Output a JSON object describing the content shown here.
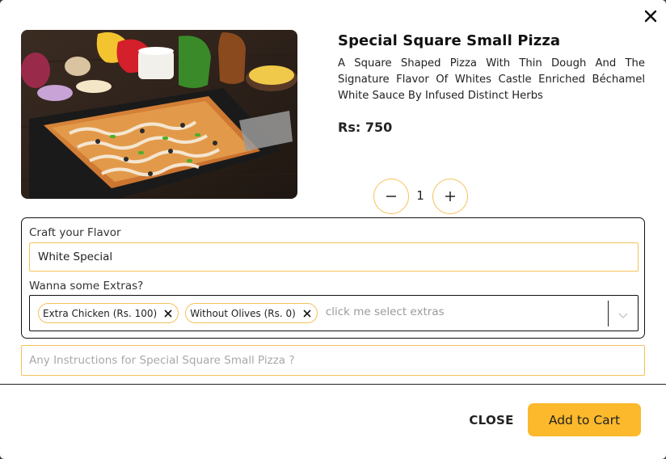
{
  "product": {
    "title": "Special Square Small Pizza",
    "description": "A Square Shaped Pizza With Thin Dough And The Signature Flavor Of Whites Castle Enriched Béchamel White Sauce By Infused Distinct Herbs",
    "price": "Rs: 750",
    "image_icon": "pizza-photo"
  },
  "quantity": {
    "value": "1",
    "decrement_icon": "minus-icon",
    "increment_icon": "plus-icon"
  },
  "options": {
    "flavor_label": "Craft your Flavor",
    "flavor_value": "White Special",
    "extras_label": "Wanna some Extras?",
    "extras_selected": [
      {
        "label": "Extra Chicken (Rs. 100)"
      },
      {
        "label": "Without Olives (Rs. 0)"
      }
    ],
    "extras_placeholder": "click me select extras"
  },
  "instructions": {
    "placeholder": "Any Instructions for Special Square Small Pizza ?",
    "value": ""
  },
  "footer": {
    "close_label": "CLOSE",
    "add_to_cart_label": "Add to Cart"
  },
  "colors": {
    "accent": "#fcb92c",
    "accent_border": "#f4c25a",
    "text": "#222222",
    "placeholder": "#9a9a9a"
  }
}
